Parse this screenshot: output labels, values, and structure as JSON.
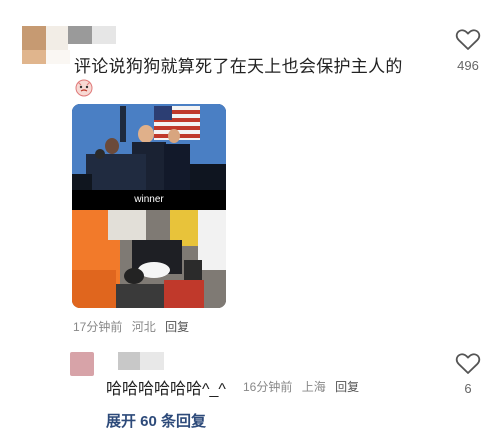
{
  "comment1": {
    "text": "评论说狗狗就算死了在天上也会保护主人的",
    "like_count": "496",
    "image": {
      "caption": "winner"
    },
    "meta": {
      "time": "17分钟前",
      "location": "河北",
      "reply_label": "回复"
    }
  },
  "reply1": {
    "text": "哈哈哈哈哈哈^_^",
    "like_count": "6",
    "meta": {
      "time": "16分钟前",
      "location": "上海",
      "reply_label": "回复"
    }
  },
  "expand_label": "展开 60 条回复",
  "colors": {
    "link": "#2d4a7a",
    "meta": "#888888",
    "avatar2": "#d7a3a8"
  }
}
